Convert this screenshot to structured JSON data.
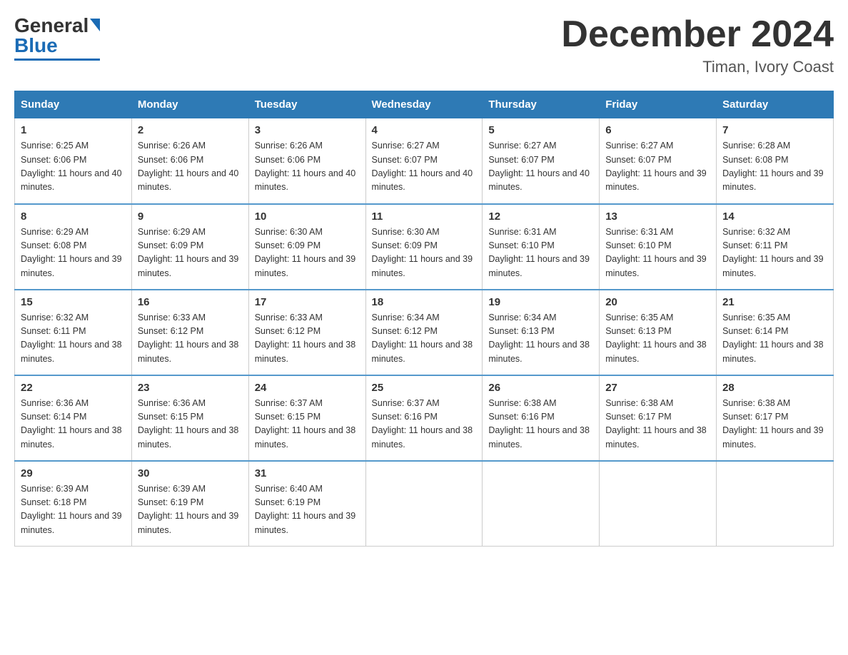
{
  "logo": {
    "text_general": "General",
    "text_blue": "Blue"
  },
  "header": {
    "month_title": "December 2024",
    "location": "Timan, Ivory Coast"
  },
  "days_of_week": [
    "Sunday",
    "Monday",
    "Tuesday",
    "Wednesday",
    "Thursday",
    "Friday",
    "Saturday"
  ],
  "weeks": [
    [
      {
        "day": "1",
        "sunrise": "6:25 AM",
        "sunset": "6:06 PM",
        "daylight": "11 hours and 40 minutes."
      },
      {
        "day": "2",
        "sunrise": "6:26 AM",
        "sunset": "6:06 PM",
        "daylight": "11 hours and 40 minutes."
      },
      {
        "day": "3",
        "sunrise": "6:26 AM",
        "sunset": "6:06 PM",
        "daylight": "11 hours and 40 minutes."
      },
      {
        "day": "4",
        "sunrise": "6:27 AM",
        "sunset": "6:07 PM",
        "daylight": "11 hours and 40 minutes."
      },
      {
        "day": "5",
        "sunrise": "6:27 AM",
        "sunset": "6:07 PM",
        "daylight": "11 hours and 40 minutes."
      },
      {
        "day": "6",
        "sunrise": "6:27 AM",
        "sunset": "6:07 PM",
        "daylight": "11 hours and 39 minutes."
      },
      {
        "day": "7",
        "sunrise": "6:28 AM",
        "sunset": "6:08 PM",
        "daylight": "11 hours and 39 minutes."
      }
    ],
    [
      {
        "day": "8",
        "sunrise": "6:29 AM",
        "sunset": "6:08 PM",
        "daylight": "11 hours and 39 minutes."
      },
      {
        "day": "9",
        "sunrise": "6:29 AM",
        "sunset": "6:09 PM",
        "daylight": "11 hours and 39 minutes."
      },
      {
        "day": "10",
        "sunrise": "6:30 AM",
        "sunset": "6:09 PM",
        "daylight": "11 hours and 39 minutes."
      },
      {
        "day": "11",
        "sunrise": "6:30 AM",
        "sunset": "6:09 PM",
        "daylight": "11 hours and 39 minutes."
      },
      {
        "day": "12",
        "sunrise": "6:31 AM",
        "sunset": "6:10 PM",
        "daylight": "11 hours and 39 minutes."
      },
      {
        "day": "13",
        "sunrise": "6:31 AM",
        "sunset": "6:10 PM",
        "daylight": "11 hours and 39 minutes."
      },
      {
        "day": "14",
        "sunrise": "6:32 AM",
        "sunset": "6:11 PM",
        "daylight": "11 hours and 39 minutes."
      }
    ],
    [
      {
        "day": "15",
        "sunrise": "6:32 AM",
        "sunset": "6:11 PM",
        "daylight": "11 hours and 38 minutes."
      },
      {
        "day": "16",
        "sunrise": "6:33 AM",
        "sunset": "6:12 PM",
        "daylight": "11 hours and 38 minutes."
      },
      {
        "day": "17",
        "sunrise": "6:33 AM",
        "sunset": "6:12 PM",
        "daylight": "11 hours and 38 minutes."
      },
      {
        "day": "18",
        "sunrise": "6:34 AM",
        "sunset": "6:12 PM",
        "daylight": "11 hours and 38 minutes."
      },
      {
        "day": "19",
        "sunrise": "6:34 AM",
        "sunset": "6:13 PM",
        "daylight": "11 hours and 38 minutes."
      },
      {
        "day": "20",
        "sunrise": "6:35 AM",
        "sunset": "6:13 PM",
        "daylight": "11 hours and 38 minutes."
      },
      {
        "day": "21",
        "sunrise": "6:35 AM",
        "sunset": "6:14 PM",
        "daylight": "11 hours and 38 minutes."
      }
    ],
    [
      {
        "day": "22",
        "sunrise": "6:36 AM",
        "sunset": "6:14 PM",
        "daylight": "11 hours and 38 minutes."
      },
      {
        "day": "23",
        "sunrise": "6:36 AM",
        "sunset": "6:15 PM",
        "daylight": "11 hours and 38 minutes."
      },
      {
        "day": "24",
        "sunrise": "6:37 AM",
        "sunset": "6:15 PM",
        "daylight": "11 hours and 38 minutes."
      },
      {
        "day": "25",
        "sunrise": "6:37 AM",
        "sunset": "6:16 PM",
        "daylight": "11 hours and 38 minutes."
      },
      {
        "day": "26",
        "sunrise": "6:38 AM",
        "sunset": "6:16 PM",
        "daylight": "11 hours and 38 minutes."
      },
      {
        "day": "27",
        "sunrise": "6:38 AM",
        "sunset": "6:17 PM",
        "daylight": "11 hours and 38 minutes."
      },
      {
        "day": "28",
        "sunrise": "6:38 AM",
        "sunset": "6:17 PM",
        "daylight": "11 hours and 39 minutes."
      }
    ],
    [
      {
        "day": "29",
        "sunrise": "6:39 AM",
        "sunset": "6:18 PM",
        "daylight": "11 hours and 39 minutes."
      },
      {
        "day": "30",
        "sunrise": "6:39 AM",
        "sunset": "6:19 PM",
        "daylight": "11 hours and 39 minutes."
      },
      {
        "day": "31",
        "sunrise": "6:40 AM",
        "sunset": "6:19 PM",
        "daylight": "11 hours and 39 minutes."
      },
      null,
      null,
      null,
      null
    ]
  ]
}
